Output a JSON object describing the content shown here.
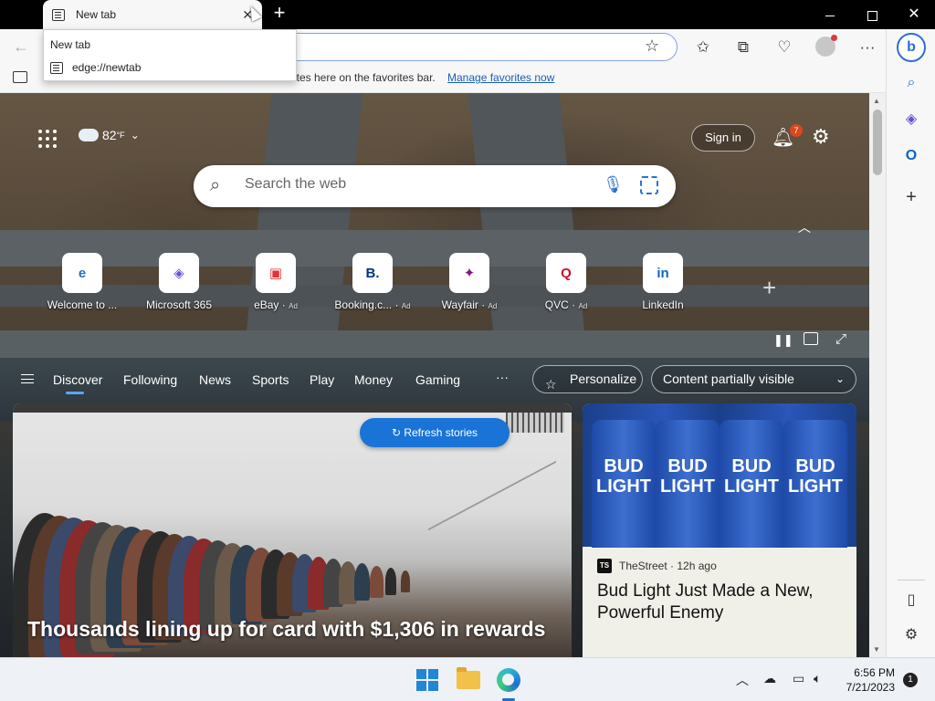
{
  "browser": {
    "tab_title": "New tab",
    "dropdown": {
      "title": "New tab",
      "url": "edge://newtab"
    },
    "favorites_bar": {
      "text": "ites here on the favorites bar.",
      "link": "Manage favorites now"
    }
  },
  "header": {
    "weather": {
      "temp": "82",
      "unit": "°F"
    },
    "sign_in": "Sign in",
    "notifications_count": "7"
  },
  "search": {
    "placeholder": "Search the web"
  },
  "quick_links": [
    {
      "label": "Welcome to ...",
      "ad": "",
      "icon": "edge-logo-icon",
      "glyph": "e",
      "color": "#1d6fd0"
    },
    {
      "label": "Microsoft 365",
      "ad": "",
      "icon": "microsoft-365-icon",
      "glyph": "◈",
      "color": "#6b4fd6"
    },
    {
      "label": "eBay",
      "ad": "Ad",
      "icon": "ebay-bag-icon",
      "glyph": "▣",
      "color": "#e53238"
    },
    {
      "label": "Booking.c...",
      "ad": "Ad",
      "icon": "booking-logo-icon",
      "glyph": "B.",
      "color": "#003580"
    },
    {
      "label": "Wayfair",
      "ad": "Ad",
      "icon": "wayfair-logo-icon",
      "glyph": "✦",
      "color": "#7f187f"
    },
    {
      "label": "QVC",
      "ad": "Ad",
      "icon": "qvc-logo-icon",
      "glyph": "Q",
      "color": "#c8102e"
    },
    {
      "label": "LinkedIn",
      "ad": "",
      "icon": "linkedin-logo-icon",
      "glyph": "in",
      "color": "#0a66c2"
    }
  ],
  "nav": {
    "items": [
      "Discover",
      "Following",
      "News",
      "Sports",
      "Play",
      "Money",
      "Gaming"
    ],
    "more": "···",
    "personalize": "Personalize",
    "content_select": "Content partially visible"
  },
  "cards": {
    "main": {
      "refresh": "Refresh stories",
      "headline": "Thousands lining up for card with $1,306 in rewards"
    },
    "side": {
      "source": "TheStreet",
      "source_logo": "TS",
      "age": "12h ago",
      "title": "Bud Light Just Made a New, Powerful Enemy",
      "can_text": "BUD LIGHT"
    }
  },
  "taskbar": {
    "time": "6:56 PM",
    "date": "7/21/2023",
    "notifications": "1"
  }
}
